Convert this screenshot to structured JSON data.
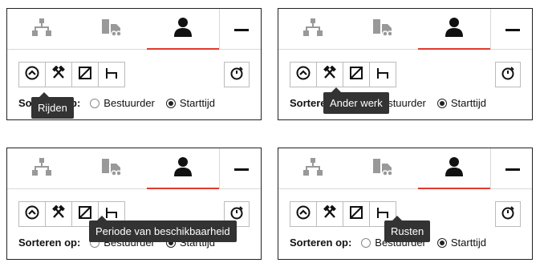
{
  "colors": {
    "accent": "#e03a2e",
    "tooltip_bg": "#333333",
    "icon_gray": "#999999"
  },
  "tabs": [
    {
      "name": "tab-hierarchy",
      "icon": "hierarchy-icon"
    },
    {
      "name": "tab-truck",
      "icon": "truck-icon"
    },
    {
      "name": "tab-driver",
      "icon": "person-icon",
      "active": true
    },
    {
      "name": "tab-minimize",
      "icon": "minus-icon"
    }
  ],
  "filters": [
    {
      "icon": "driving-icon",
      "tooltip": "Rijden"
    },
    {
      "icon": "other-work-icon",
      "tooltip": "Ander werk"
    },
    {
      "icon": "availability-icon",
      "tooltip": "Periode van beschikbaarheid"
    },
    {
      "icon": "rest-icon",
      "tooltip": "Rusten"
    }
  ],
  "sort": {
    "label": "Sorteren op:",
    "options": [
      "Bestuurder",
      "Starttijd"
    ],
    "selected": "Starttijd"
  },
  "panels": [
    {
      "tooltip": "Rijden"
    },
    {
      "tooltip": "Ander werk"
    },
    {
      "tooltip": "Periode van beschikbaarheid"
    },
    {
      "tooltip": "Rusten"
    }
  ]
}
